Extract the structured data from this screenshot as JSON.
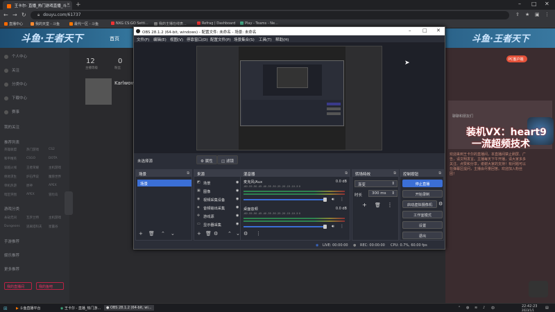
{
  "browser": {
    "tab_title": "王卡尔- 直播_热门游戏直播_斗...",
    "url": "douyu.com/61737",
    "bookmarks": [
      {
        "label": "直播中心",
        "color": "#ff6a00"
      },
      {
        "label": "我的天堂 - 斗鱼",
        "color": "#ff8a30"
      },
      {
        "label": "最代一区 - 斗鱼",
        "color": "#f70"
      },
      {
        "label": "NXG CS:GO Setti...",
        "color": "#e33"
      },
      {
        "label": "我的主播在线表...",
        "color": "#888"
      },
      {
        "label": "Refrag | Dashboard",
        "color": "#e33"
      },
      {
        "label": "Play - Teams - Ne...",
        "color": "#4a8"
      }
    ]
  },
  "douyu": {
    "logo": "斗鱼·王者天下",
    "nav_first": "首页",
    "sidebar_items": [
      "个人中心",
      "关注",
      "分类中心",
      "下载中心",
      "赛事"
    ],
    "sidebar_sections": [
      "我的关注",
      "推荐列表",
      "游戏分类"
    ],
    "sidebar_grid": [
      [
        "英雄联盟",
        "热门游戏",
        "CS2"
      ],
      [
        "和平精英",
        "CSGO",
        "DOTA"
      ],
      [
        "穿越火线",
        "王者荣耀",
        "主机游戏"
      ],
      [
        "绝地求生",
        "炉石传说",
        "魔兽世界"
      ],
      [
        "单机热游",
        "原神",
        "APEX"
      ],
      [
        "暗区突围",
        "APEX",
        "冒险岛"
      ],
      [
        "永劫无间",
        "瓦罗兰特",
        "主机游戏"
      ],
      [
        "Dungeons",
        "逃离塔科夫",
        "星露谷"
      ]
    ],
    "sidebar_more": [
      "手游推荐",
      "娱乐推荐",
      "更多推荐"
    ],
    "sidebar_btns": [
      "我的直播间",
      "我的鱼吧"
    ],
    "stats": [
      "12",
      "0"
    ],
    "stats_labels": [
      "主播等级",
      "粉丝"
    ],
    "streamer_name": "Karlwow",
    "pc_button": "PC客户端",
    "chat_header": "聊聊和朋友们",
    "overlay_line1": "装机VX：heart9",
    "overlay_line2": "一流超频技术",
    "chat_body": "欢迎来到王卡尔的直播间，本直播间禁止刷屏、广告，请文明发言。主播每天下午开播，请大家多多关注、点赞和分享，谢谢大家的支持！有问题可以在弹幕区提问，主播会尽量回答。欢迎加入粉丝团！"
  },
  "obs": {
    "title": "OBS 28.1.2 (64-bit, windows) - 配置文件: 未命名 - 场景: 未命名",
    "menu": [
      "文件(F)",
      "编辑(E)",
      "视图(V)",
      "停靠窗口(D)",
      "配置文件(P)",
      "场景集合(S)",
      "工具(T)",
      "帮助(H)"
    ],
    "no_source": "未选择源",
    "prop_btn": "属性",
    "filter_btn": "滤镜",
    "docks": {
      "scenes": "场景",
      "sources": "来源",
      "mixer": "混音器",
      "transitions": "转场特效",
      "controls": "控制按钮"
    },
    "scene_item": "场景",
    "sources": [
      {
        "label": "场景",
        "icon": "◩"
      },
      {
        "label": "图像",
        "icon": "▣"
      },
      {
        "label": "视频采集设备",
        "icon": "◉"
      },
      {
        "label": "音频输出采集",
        "icon": "◈"
      },
      {
        "label": "游戏源",
        "icon": "✜"
      },
      {
        "label": "显示器采集",
        "icon": "▭"
      }
    ],
    "mixer": [
      {
        "name": "麦克风/Aux",
        "db": "0.0 dB"
      },
      {
        "name": "桌面音频",
        "db": "0.0 dB"
      }
    ],
    "mixer_scale": "-60 -55 -50 -45 -40 -35 -30 -25 -20 -15 -10 -5 0",
    "transition": {
      "type": "渐变",
      "duration_label": "时长",
      "duration": "300 ms"
    },
    "controls": [
      "停止直播",
      "开始录制",
      "启动虚拟摄像机",
      "工作室模式",
      "设置",
      "退出"
    ],
    "status": {
      "live": "LIVE: 00:00:00",
      "rec": "REC: 00:00:00",
      "cpu": "CPU: 0.7%, 60.00 fps"
    }
  },
  "taskbar": {
    "items": [
      "斗鱼直播平台",
      "王卡尔 - 直播_热门游...",
      "OBS 28.1.2 (64-bit, wi..."
    ],
    "time": "22:42:23",
    "date": "2023/1/1"
  }
}
